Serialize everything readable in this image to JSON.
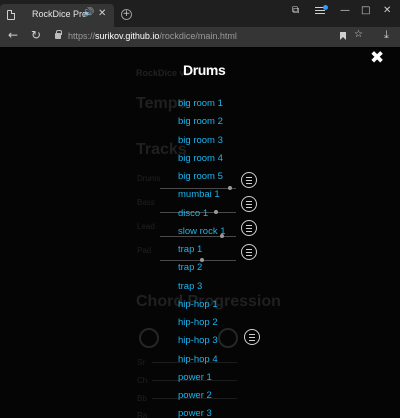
{
  "browser": {
    "tab_title": "RockDice Pro",
    "new_tab_label": "+",
    "url_scheme": "https://",
    "url_host": "surikov.github.io",
    "url_path": "/rockdice/main.html"
  },
  "icons": {
    "tab_favicon": "page-icon",
    "audio": "speaker-icon",
    "tab_close": "close-icon",
    "back": "arrow-left-icon",
    "reload": "reload-icon",
    "lock": "lock-icon",
    "star": "star-icon",
    "bookmark": "bookmark-icon",
    "download": "download-icon",
    "overlay_close": "close-icon",
    "track_menu": "hamburger-icon"
  },
  "background_app": {
    "app_title": "RockDice v2",
    "tempo_heading": "Tempo",
    "tracks_heading": "Tracks",
    "tracks": [
      "Drums",
      "Bass",
      "Lead",
      "Pad"
    ],
    "chord_heading": "Chord Progression",
    "extra_labels": [
      "Sr",
      "Ch",
      "Bb",
      "Ra"
    ]
  },
  "overlay": {
    "title": "Drums",
    "items": [
      "big room 1",
      "big room 2",
      "big room 3",
      "big room 4",
      "big room 5",
      "mumbai 1",
      "disco 1",
      "slow rock 1",
      "trap 1",
      "trap 2",
      "trap 3",
      "hip-hop 1",
      "hip-hop 2",
      "hip-hop 3",
      "hip-hop 4",
      "power 1",
      "power 2",
      "power 3"
    ]
  },
  "colors": {
    "menu_link": "#19b6f0",
    "overlay_background": "#000000",
    "title": "#ffffff"
  }
}
